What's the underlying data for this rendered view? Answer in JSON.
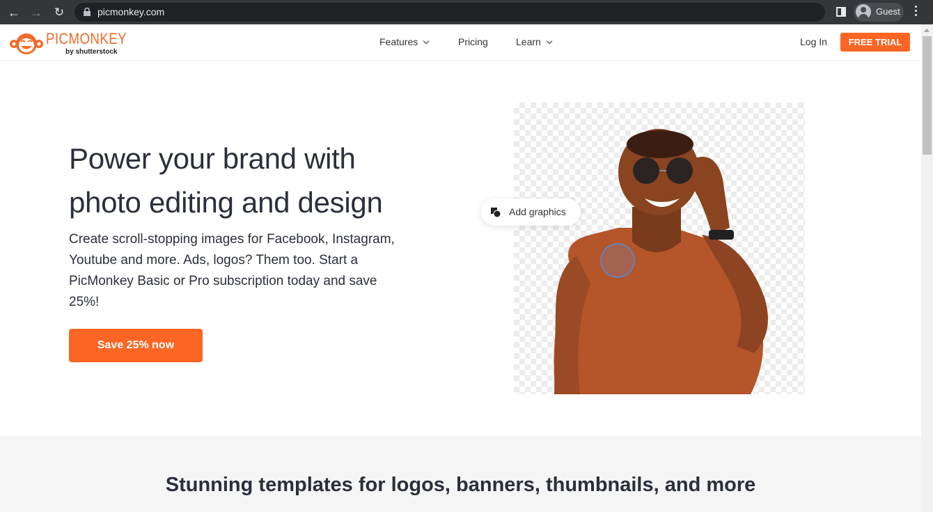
{
  "browser": {
    "url": "picmonkey.com",
    "profile_label": "Guest"
  },
  "header": {
    "logo_text": "PICMONKEY",
    "logo_byline": "by shutterstock",
    "nav": [
      {
        "label": "Features",
        "has_dropdown": true
      },
      {
        "label": "Pricing",
        "has_dropdown": false
      },
      {
        "label": "Learn",
        "has_dropdown": true
      }
    ],
    "login_label": "Log In",
    "free_trial_label": "FREE TRIAL"
  },
  "hero": {
    "title_line1": "Power your brand with",
    "title_line2": "photo editing and design",
    "description": "Create scroll-stopping images for Facebook, Instagram, Youtube and more. Ads, logos? Them too. Start a PicMonkey Basic or Pro subscription today and save 25%!",
    "cta_label": "Save 25% now",
    "image_tooltip": "Add graphics"
  },
  "templates": {
    "title": "Stunning templates for logos, banners, thumbnails, and more"
  },
  "colors": {
    "brand_orange": "#fc6524",
    "text_dark": "#2b2f3a"
  }
}
